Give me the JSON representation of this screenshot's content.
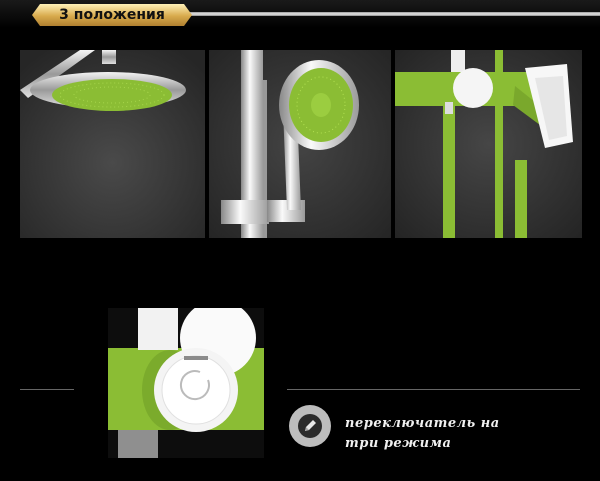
{
  "header": {
    "badge_label": "3 положения"
  },
  "colors": {
    "accent_green": "#8bbd34",
    "badge_gold": "#d8aa4c",
    "background": "#000000"
  },
  "caption": {
    "icon": "pencil-icon",
    "line1": "переключатель на",
    "line2": "три режима"
  }
}
